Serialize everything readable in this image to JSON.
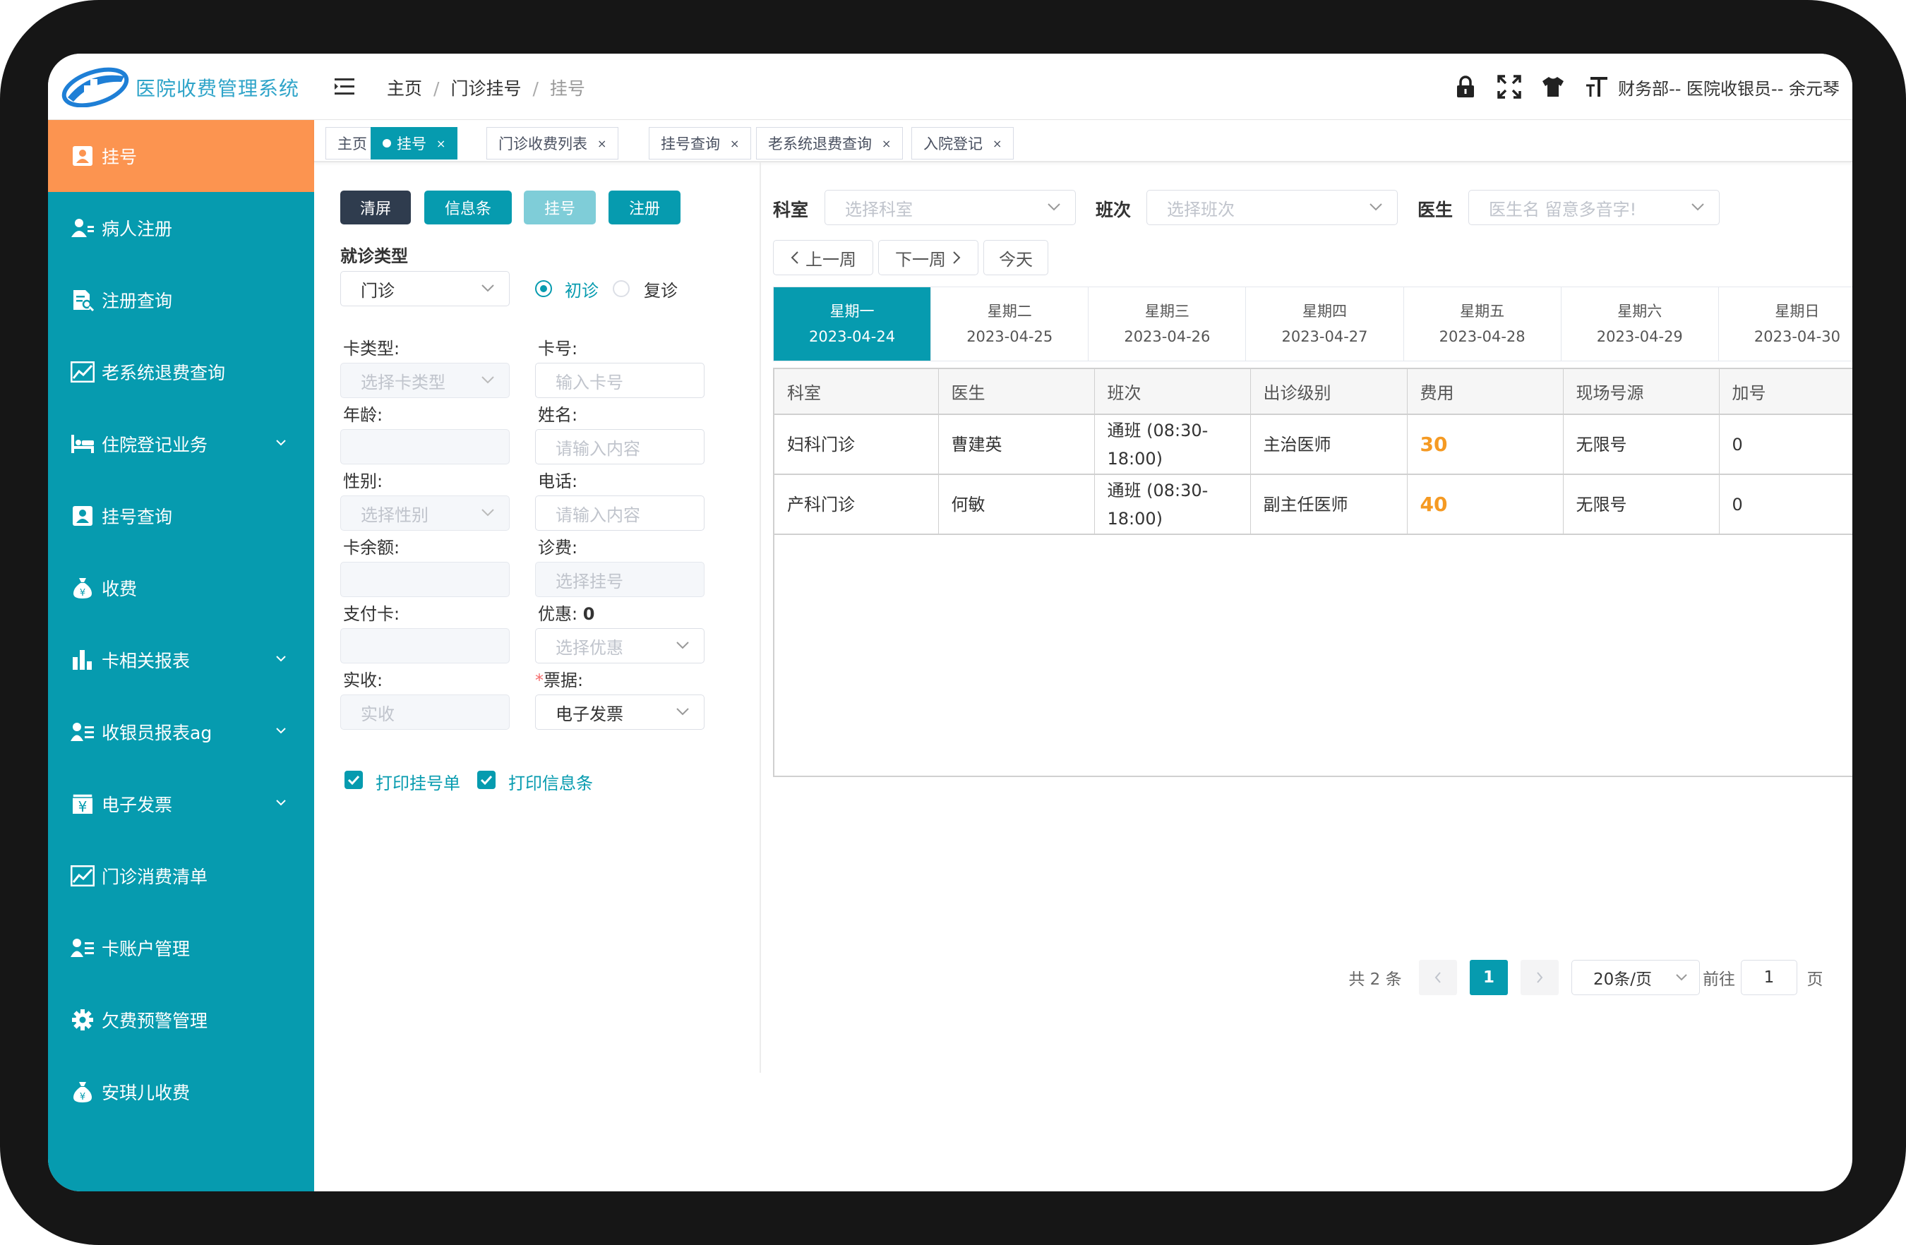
{
  "app": {
    "title": "医院收费管理系统"
  },
  "breadcrumb": [
    "主页",
    "门诊挂号",
    "挂号"
  ],
  "header": {
    "user": "财务部-- 医院收银员-- 余元琴"
  },
  "sidebar": {
    "items": [
      {
        "label": "挂号",
        "icon": "user-card-icon"
      },
      {
        "label": "病人注册",
        "icon": "user-add-icon"
      },
      {
        "label": "注册查询",
        "icon": "doc-search-icon"
      },
      {
        "label": "老系统退费查询",
        "icon": "line-chart-icon"
      },
      {
        "label": "住院登记业务",
        "icon": "bed-icon"
      },
      {
        "label": "挂号查询",
        "icon": "user-card-icon"
      },
      {
        "label": "收费",
        "icon": "money-bag-icon"
      },
      {
        "label": "卡相关报表",
        "icon": "bar-chart-icon"
      },
      {
        "label": "收银员报表ag",
        "icon": "user-list-icon"
      },
      {
        "label": "电子发票",
        "icon": "yuan-doc-icon"
      },
      {
        "label": "门诊消费清单",
        "icon": "line-chart-icon"
      },
      {
        "label": "卡账户管理",
        "icon": "user-list-icon"
      },
      {
        "label": "欠费预警管理",
        "icon": "gear-icon"
      },
      {
        "label": "安琪儿收费",
        "icon": "money-bag-icon"
      }
    ]
  },
  "tabs": [
    {
      "label": "主页"
    },
    {
      "label": "挂号",
      "close": "×"
    },
    {
      "label": "门诊收费列表",
      "close": "×"
    },
    {
      "label": "挂号查询",
      "close": "×"
    },
    {
      "label": "老系统退费查询",
      "close": "×"
    },
    {
      "label": "入院登记",
      "close": "×"
    }
  ],
  "form": {
    "buttons": {
      "clear": "清屏",
      "info": "信息条",
      "register": "挂号",
      "signup": "注册"
    },
    "visit_type": {
      "label": "就诊类型",
      "value": "门诊",
      "first": "初诊",
      "return": "复诊"
    },
    "card_type": {
      "label": "卡类型:",
      "placeholder": "选择卡类型"
    },
    "card_no": {
      "label": "卡号:",
      "placeholder": "输入卡号"
    },
    "age": {
      "label": "年龄:"
    },
    "name": {
      "label": "姓名:",
      "placeholder": "请输入内容"
    },
    "gender": {
      "label": "性别:",
      "placeholder": "选择性别"
    },
    "phone": {
      "label": "电话:",
      "placeholder": "请输入内容"
    },
    "balance": {
      "label": "卡余额:"
    },
    "fee": {
      "label": "诊费:",
      "placeholder": "选择挂号"
    },
    "pay_card": {
      "label": "支付卡:"
    },
    "discount": {
      "label": "优惠:",
      "value": "0",
      "placeholder": "选择优惠"
    },
    "received": {
      "label": "实收:",
      "placeholder": "实收"
    },
    "invoice": {
      "required": "*",
      "label": "票据:",
      "value": "电子发票"
    },
    "print": {
      "reg_slip": "打印挂号单",
      "info_slip": "打印信息条"
    }
  },
  "filters": {
    "dept": {
      "label": "科室",
      "placeholder": "选择科室"
    },
    "shift": {
      "label": "班次",
      "placeholder": "选择班次"
    },
    "doctor": {
      "label": "医生",
      "placeholder": "医生名 留意多音字!"
    },
    "prev_week": "上一周",
    "next_week": "下一周",
    "today": "今天"
  },
  "week": [
    {
      "day": "星期一",
      "date": "2023-04-24"
    },
    {
      "day": "星期二",
      "date": "2023-04-25"
    },
    {
      "day": "星期三",
      "date": "2023-04-26"
    },
    {
      "day": "星期四",
      "date": "2023-04-27"
    },
    {
      "day": "星期五",
      "date": "2023-04-28"
    },
    {
      "day": "星期六",
      "date": "2023-04-29"
    },
    {
      "day": "星期日",
      "date": "2023-04-30"
    }
  ],
  "table": {
    "headers": [
      "科室",
      "医生",
      "班次",
      "出诊级别",
      "费用",
      "现场号源",
      "加号"
    ],
    "rows": [
      [
        "妇科门诊",
        "曹建英",
        "通班 (08:30-18:00)",
        "主治医师",
        "30",
        "无限号",
        "0"
      ],
      [
        "产科门诊",
        "何敏",
        "通班 (08:30-18:00)",
        "副主任医师",
        "40",
        "无限号",
        "0"
      ]
    ]
  },
  "pagination": {
    "total": "共 2 条",
    "current": "1",
    "page_size": "20条/页",
    "goto": "前往",
    "goto_value": "1",
    "page_unit": "页"
  },
  "colors": {
    "primary": "#069baf",
    "active_nav": "#fc9450",
    "fee": "#f59a23"
  }
}
